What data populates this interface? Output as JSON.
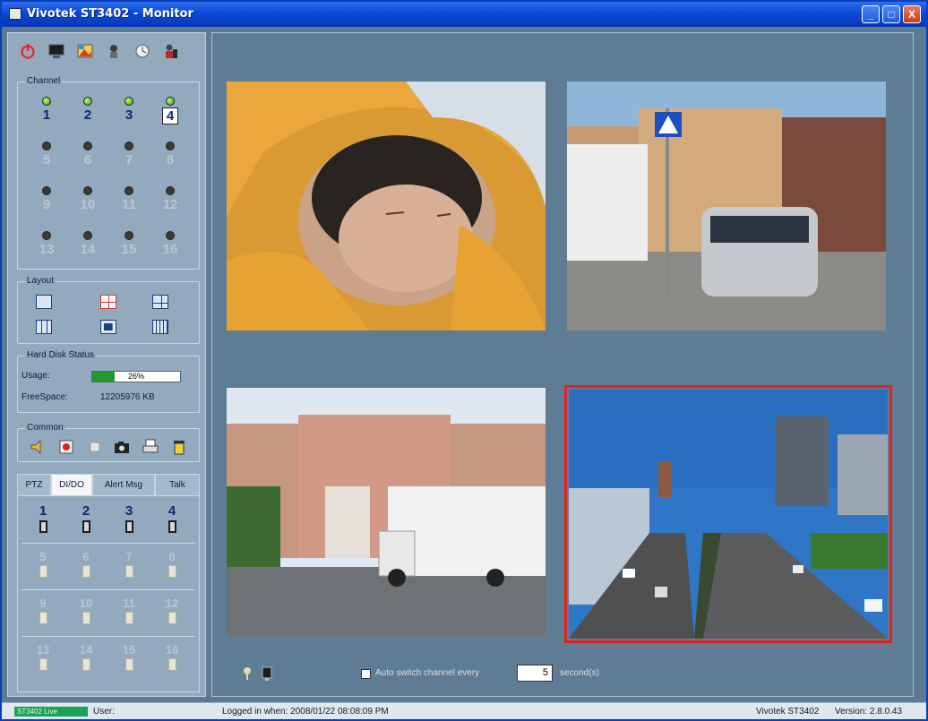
{
  "window": {
    "title": "Vivotek ST3402 - Monitor",
    "minimize": "_",
    "maximize": "□",
    "close": "X"
  },
  "toolbar": {
    "icons": [
      "power-icon",
      "monitor-icon",
      "image-icon",
      "network-icon",
      "clock-icon",
      "user-icon"
    ]
  },
  "channel": {
    "label": "Channel",
    "items": [
      {
        "num": "1",
        "on": true
      },
      {
        "num": "2",
        "on": true
      },
      {
        "num": "3",
        "on": true
      },
      {
        "num": "4",
        "on": true,
        "active": true
      },
      {
        "num": "5"
      },
      {
        "num": "6"
      },
      {
        "num": "7"
      },
      {
        "num": "8"
      },
      {
        "num": "9"
      },
      {
        "num": "10"
      },
      {
        "num": "11"
      },
      {
        "num": "12"
      },
      {
        "num": "13"
      },
      {
        "num": "14"
      },
      {
        "num": "15"
      },
      {
        "num": "16"
      }
    ]
  },
  "layout": {
    "label": "Layout"
  },
  "hdd": {
    "label": "Hard Disk Status",
    "usage_label": "Usage:",
    "usage_value": "26%",
    "usage_fraction": 0.26,
    "free_label": "FreeSpace:",
    "free_value": "12205976 KB"
  },
  "common": {
    "label": "Common",
    "icons": [
      "audio-icon",
      "record-icon",
      "stop-icon",
      "snapshot-icon",
      "print-icon",
      "delete-icon"
    ]
  },
  "tabs": [
    "PTZ",
    "DI/DO",
    "Alert Msg",
    "Talk"
  ],
  "dio": {
    "items": [
      "1",
      "2",
      "3",
      "4",
      "5",
      "6",
      "7",
      "8",
      "9",
      "10",
      "11",
      "12",
      "13",
      "14",
      "15",
      "16"
    ]
  },
  "main": {
    "auto_switch_label": "Auto switch channel every",
    "seconds_value": "5",
    "seconds_label": "second(s)"
  },
  "statusbar": {
    "indicator": "ST3402 Live",
    "user": "User:",
    "login": "Logged in when: 2008/01/22 08:08:09 PM",
    "product": "Vivotek ST3402",
    "version": "Version: 2.8.0.43"
  },
  "colors": {
    "accent": "#0b49d6",
    "selection": "#e3201c",
    "usage": "#1f9b2a"
  }
}
